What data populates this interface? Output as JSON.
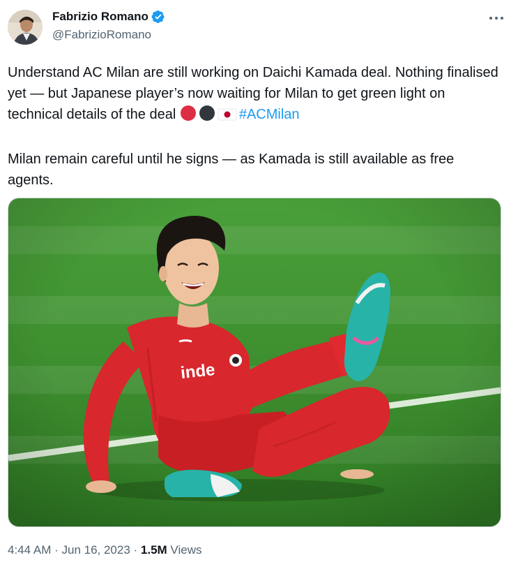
{
  "author": {
    "display_name": "Fabrizio Romano",
    "handle": "@FabrizioRomano",
    "verified": true,
    "avatar_icon": "avatar-portrait"
  },
  "tweet": {
    "line1": "Understand AC Milan are still working on Daichi Kamada deal. Nothing finalised yet — but Japanese player’s now waiting for Milan to get green light on technical details of the deal ",
    "emojis": [
      "red-circle-icon",
      "black-circle-icon",
      "japan-flag-icon"
    ],
    "hashtag": "#ACMilan",
    "line2": "Milan remain careful until he signs — as Kamada is still available as free agents."
  },
  "media": {
    "shirt_text": "inde",
    "description_icon": "footballer-celebration-photo"
  },
  "meta": {
    "time": "4:44 AM",
    "sep1": " · ",
    "date": "Jun 16, 2023",
    "sep2": " · ",
    "views_count": "1.5M",
    "views_label": " Views"
  },
  "colors": {
    "link": "#1d9bf0",
    "verified": "#1d9bf0",
    "text": "#0f1419",
    "secondary": "#536471",
    "kit_red": "#d8272d",
    "pitch": "#3f8f2e"
  }
}
